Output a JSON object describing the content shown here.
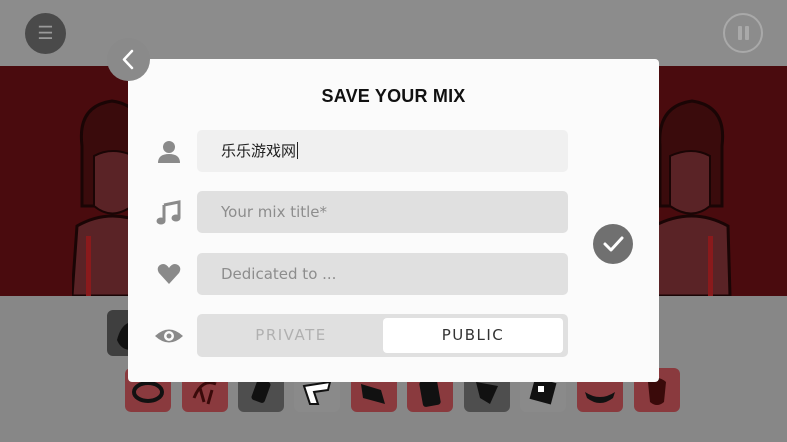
{
  "dialog": {
    "title": "SAVE YOUR MIX",
    "name_value": "乐乐游戏网",
    "title_placeholder": "Your mix title*",
    "dedication_placeholder": "Dedicated to ...",
    "visibility": {
      "options": [
        "PRIVATE",
        "PUBLIC"
      ],
      "selected": "PUBLIC"
    }
  },
  "icons": {
    "menu": "menu-icon",
    "pause": "pause-icon",
    "back": "chevron-left-icon",
    "user": "user-icon",
    "music": "music-note-icon",
    "heart": "heart-icon",
    "eye": "eye-icon",
    "confirm": "checkmark-icon"
  },
  "colors": {
    "stage_bg": "#4a0b0e",
    "dialog_bg": "#fbfbfb",
    "field_bg": "#e0e0e0",
    "icon_gray": "#8a8a8a",
    "slot_red": "#8a3a3e"
  }
}
